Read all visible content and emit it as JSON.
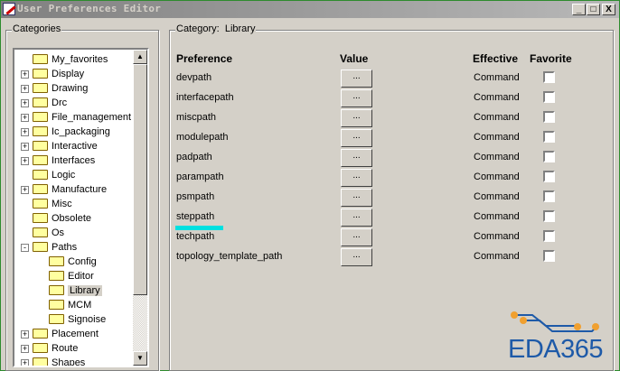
{
  "window": {
    "title": "User Preferences Editor",
    "minimize": "_",
    "maximize": "□",
    "close": "X"
  },
  "categories": {
    "label": "Categories",
    "items": [
      {
        "label": "My_favorites",
        "level": 0,
        "expander": ""
      },
      {
        "label": "Display",
        "level": 0,
        "expander": "+"
      },
      {
        "label": "Drawing",
        "level": 0,
        "expander": "+"
      },
      {
        "label": "Drc",
        "level": 0,
        "expander": "+"
      },
      {
        "label": "File_management",
        "level": 0,
        "expander": "+"
      },
      {
        "label": "Ic_packaging",
        "level": 0,
        "expander": "+"
      },
      {
        "label": "Interactive",
        "level": 0,
        "expander": "+"
      },
      {
        "label": "Interfaces",
        "level": 0,
        "expander": "+"
      },
      {
        "label": "Logic",
        "level": 0,
        "expander": ""
      },
      {
        "label": "Manufacture",
        "level": 0,
        "expander": "+"
      },
      {
        "label": "Misc",
        "level": 0,
        "expander": ""
      },
      {
        "label": "Obsolete",
        "level": 0,
        "expander": ""
      },
      {
        "label": "Os",
        "level": 0,
        "expander": ""
      },
      {
        "label": "Paths",
        "level": 0,
        "expander": "-"
      },
      {
        "label": "Config",
        "level": 1,
        "expander": ""
      },
      {
        "label": "Editor",
        "level": 1,
        "expander": ""
      },
      {
        "label": "Library",
        "level": 1,
        "expander": "",
        "selected": true
      },
      {
        "label": "MCM",
        "level": 1,
        "expander": ""
      },
      {
        "label": "Signoise",
        "level": 1,
        "expander": ""
      },
      {
        "label": "Placement",
        "level": 0,
        "expander": "+"
      },
      {
        "label": "Route",
        "level": 0,
        "expander": "+"
      },
      {
        "label": "Shapes",
        "level": 0,
        "expander": "+"
      }
    ]
  },
  "panel": {
    "label_prefix": "Category:",
    "category": "Library",
    "headers": {
      "preference": "Preference",
      "value": "Value",
      "effective": "Effective",
      "favorite": "Favorite"
    },
    "rows": [
      {
        "name": "devpath",
        "value": "...",
        "effective": "Command",
        "favorite": false
      },
      {
        "name": "interfacepath",
        "value": "...",
        "effective": "Command",
        "favorite": false
      },
      {
        "name": "miscpath",
        "value": "...",
        "effective": "Command",
        "favorite": false
      },
      {
        "name": "modulepath",
        "value": "...",
        "effective": "Command",
        "favorite": false
      },
      {
        "name": "padpath",
        "value": "...",
        "effective": "Command",
        "favorite": false
      },
      {
        "name": "parampath",
        "value": "...",
        "effective": "Command",
        "favorite": false
      },
      {
        "name": "psmpath",
        "value": "...",
        "effective": "Command",
        "favorite": false
      },
      {
        "name": "steppath",
        "value": "...",
        "effective": "Command",
        "favorite": false
      },
      {
        "name": "techpath",
        "value": "...",
        "effective": "Command",
        "favorite": false
      },
      {
        "name": "topology_template_path",
        "value": "...",
        "effective": "Command",
        "favorite": false
      }
    ]
  },
  "watermark": {
    "text": "EDA365"
  },
  "colors": {
    "highlight": "#00e0e0",
    "logo": "#1e5aa8",
    "logo_dots": "#f0a030"
  }
}
